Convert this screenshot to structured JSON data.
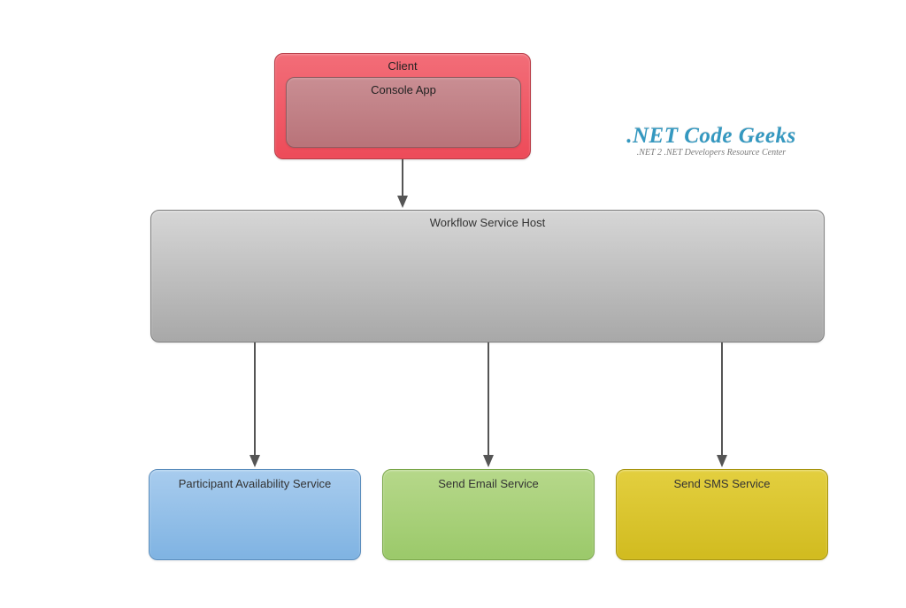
{
  "client": {
    "outer_label": "Client",
    "inner_label": "Console App"
  },
  "workflow_host": {
    "label": "Workflow Service Host"
  },
  "services": [
    {
      "label": "Participant Availability Service"
    },
    {
      "label": "Send Email Service"
    },
    {
      "label": "Send SMS Service"
    }
  ],
  "watermark": {
    "title": ".NET Code Geeks",
    "subtitle": ".NET 2 .NET Developers Resource Center"
  },
  "chart_data": {
    "type": "diagram",
    "nodes": [
      {
        "id": "client",
        "label": "Client",
        "children": [
          {
            "id": "console_app",
            "label": "Console App"
          }
        ]
      },
      {
        "id": "workflow_host",
        "label": "Workflow Service Host"
      },
      {
        "id": "participant_service",
        "label": "Participant Availability Service"
      },
      {
        "id": "email_service",
        "label": "Send Email Service"
      },
      {
        "id": "sms_service",
        "label": "Send SMS Service"
      }
    ],
    "edges": [
      {
        "from": "client",
        "to": "workflow_host"
      },
      {
        "from": "workflow_host",
        "to": "participant_service"
      },
      {
        "from": "workflow_host",
        "to": "email_service"
      },
      {
        "from": "workflow_host",
        "to": "sms_service"
      }
    ]
  }
}
